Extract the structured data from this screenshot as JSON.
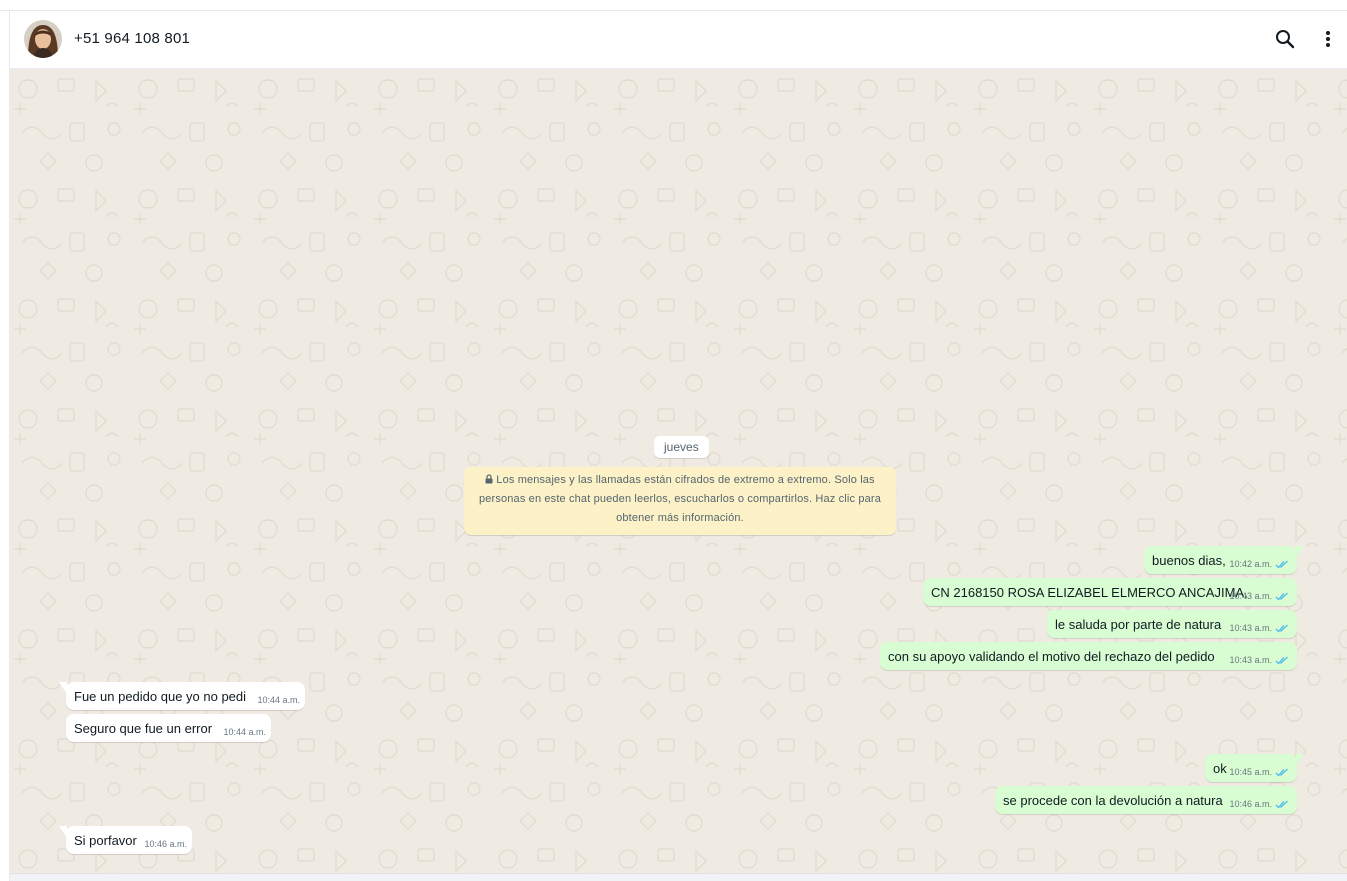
{
  "header": {
    "contact_name": "+51 964 108 801"
  },
  "icons": {
    "search": "search-icon",
    "menu": "more-vertical-icon",
    "lock": "lock-icon",
    "read": "double-check-icon"
  },
  "colors": {
    "chat_background": "#efeae2",
    "outgoing_bubble": "#d9fdd3",
    "incoming_bubble": "#ffffff",
    "notice_background": "#fdf2c7",
    "read_tick": "#53bdeb"
  },
  "chat": {
    "date_label": "jueves",
    "encryption_notice": "Los mensajes y las llamadas están cifrados de extremo a extremo. Solo las personas en este chat pueden leerlos, escucharlos o compartirlos. Haz clic para obtener más información.",
    "messages": [
      {
        "direction": "out",
        "text": "buenos dias,",
        "time": "10:42 a.m.",
        "status": "read"
      },
      {
        "direction": "out",
        "text": "CN 2168150 ROSA ELIZABEL ELMERCO ANCAJIMA,",
        "time": "10:43 a.m.",
        "status": "read"
      },
      {
        "direction": "out",
        "text": "le saluda por parte de natura",
        "time": "10:43 a.m.",
        "status": "read"
      },
      {
        "direction": "out",
        "text": "con su apoyo validando el motivo del rechazo del pedido",
        "time": "10:43 a.m.",
        "status": "read"
      },
      {
        "direction": "in",
        "text": "Fue un pedido que yo no pedi",
        "time": "10:44 a.m."
      },
      {
        "direction": "in",
        "text": "Seguro que fue un error",
        "time": "10:44 a.m."
      },
      {
        "direction": "out",
        "text": "ok",
        "time": "10:45 a.m.",
        "status": "read"
      },
      {
        "direction": "out",
        "text": "se procede con la devolución a natura",
        "time": "10:46 a.m.",
        "status": "read"
      },
      {
        "direction": "in",
        "text": "Si porfavor",
        "time": "10:46 a.m."
      }
    ]
  }
}
